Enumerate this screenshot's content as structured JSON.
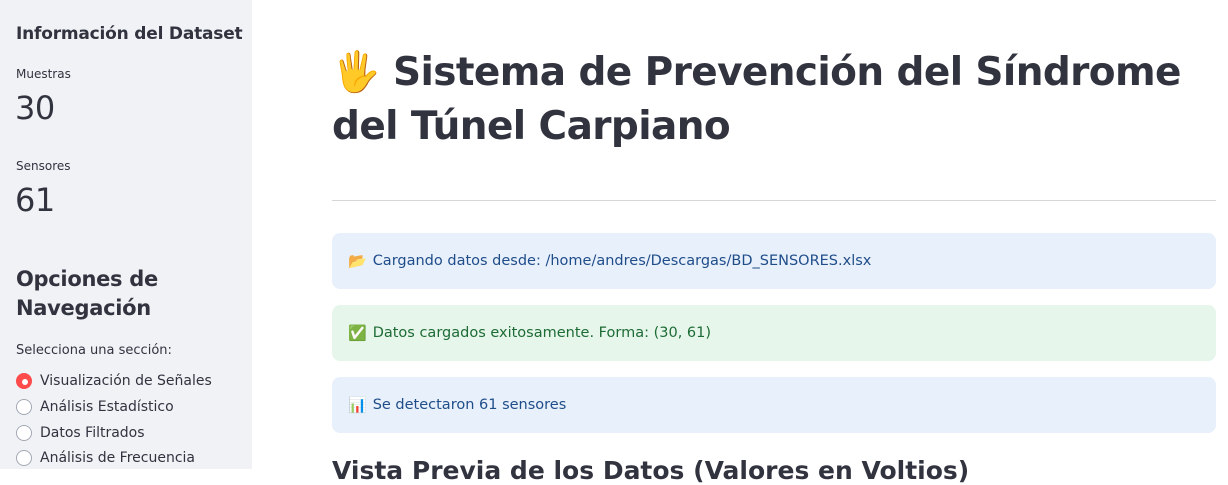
{
  "sidebar": {
    "heading": "Información del Dataset",
    "metrics": [
      {
        "label": "Muestras",
        "value": "30"
      },
      {
        "label": "Sensores",
        "value": "61"
      }
    ],
    "nav_title": "Opciones de Navegación",
    "radio_caption": "Selecciona una sección:",
    "radio_options": [
      {
        "label": "Visualización de Señales",
        "selected": true
      },
      {
        "label": "Análisis Estadístico",
        "selected": false
      },
      {
        "label": "Datos Filtrados",
        "selected": false
      },
      {
        "label": "Análisis de Frecuencia",
        "selected": false
      }
    ],
    "accent_color": "#ff4b4b"
  },
  "main": {
    "title_icon": "🖐",
    "title": "Sistema de Prevención del Síndrome del Túnel Carpiano",
    "alerts": [
      {
        "type": "info",
        "icon": "📂",
        "text": "Cargando datos desde: /home/andres/Descargas/BD_SENSORES.xlsx"
      },
      {
        "type": "success",
        "icon": "✅",
        "text": "Datos cargados exitosamente. Forma: (30, 61)"
      },
      {
        "type": "info",
        "icon": "📊",
        "text": "Se detectaron 61 sensores"
      }
    ],
    "section_heading": "Vista Previa de los Datos (Valores en Voltios)"
  }
}
